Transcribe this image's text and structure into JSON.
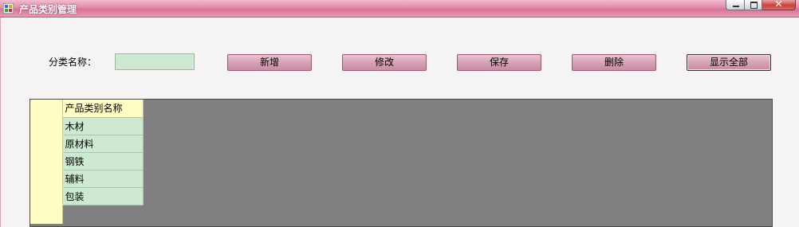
{
  "window": {
    "title": "产品类别管理",
    "controls": {
      "minimize": "min-icon",
      "maximize": "max-icon",
      "close": "✕"
    }
  },
  "form": {
    "category_label": "分类名称：",
    "category_value": "",
    "buttons": {
      "add": "新增",
      "edit": "修改",
      "save": "保存",
      "delete": "删除",
      "show_all": "显示全部"
    }
  },
  "grid": {
    "column_header": "产品类别名称",
    "rows": [
      "木材",
      "原材料",
      "钢铁",
      "辅料",
      "包装"
    ]
  },
  "colors": {
    "title_bar": "#e48aaa",
    "button": "#d7a2b7",
    "input_bg": "#cde9d2",
    "grid_bg": "#808080",
    "header_bg": "#fffec4"
  }
}
